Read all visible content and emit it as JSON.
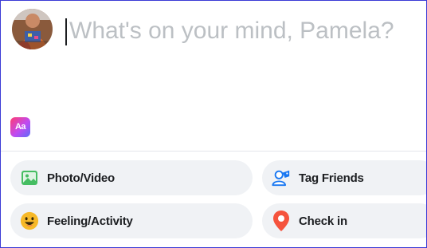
{
  "composer": {
    "placeholder": "What's on your mind, Pamela?",
    "background_icon_text": "Aa"
  },
  "actions": [
    {
      "label": "Photo/Video",
      "icon": "photo-icon",
      "color": "#45bd62"
    },
    {
      "label": "Tag Friends",
      "icon": "tag-friends-icon",
      "color": "#1877f2"
    },
    {
      "label": "Feeling/Activity",
      "icon": "feeling-icon",
      "color": "#f7b928"
    },
    {
      "label": "Check in",
      "icon": "location-pin-icon",
      "color": "#f5533d"
    }
  ]
}
